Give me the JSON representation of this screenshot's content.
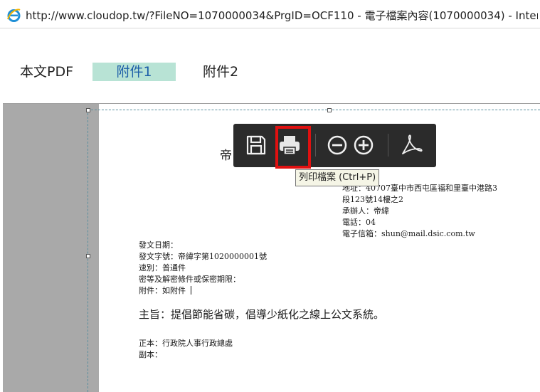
{
  "window": {
    "title": "http://www.cloudop.tw/?FileNO=1070000034&PrgID=OCF110 - 電子檔案內容(1070000034) - Inter..."
  },
  "tabs": [
    {
      "label": "本文PDF",
      "active": false
    },
    {
      "label": "附件1",
      "active": true
    },
    {
      "label": "附件2",
      "active": false
    }
  ],
  "toolbar": {
    "buttons": [
      "save-icon",
      "print-icon",
      "zoom-out-icon",
      "zoom-in-icon",
      "acrobat-icon"
    ],
    "tooltip": "列印檔案 (Ctrl+P)"
  },
  "document": {
    "header_char": "帝",
    "address_line1": "地址：40707臺中市西屯區福和里臺中港路3",
    "address_line2": "段123號14樓之2",
    "handler": "承辦人：帝緯",
    "phone": "電話：04",
    "email": "電子信箱：shun@mail.dsic.com.tw",
    "meta": [
      "發文日期：",
      "發文字號：帝緯字第1020000001號",
      "速別：普通件",
      "密等及解密條件或保密期限：",
      "附件：如附件"
    ],
    "subject": "主旨：提倡節能省碳，倡導少紙化之線上公文系統。",
    "recipients": [
      "正本：行政院人事行政總處",
      "副本："
    ]
  },
  "colors": {
    "active_tab_bg": "#b8e3d5",
    "active_tab_text": "#1e5fa8",
    "toolbar_bg": "#2b2b2b",
    "highlight": "#e01010"
  }
}
